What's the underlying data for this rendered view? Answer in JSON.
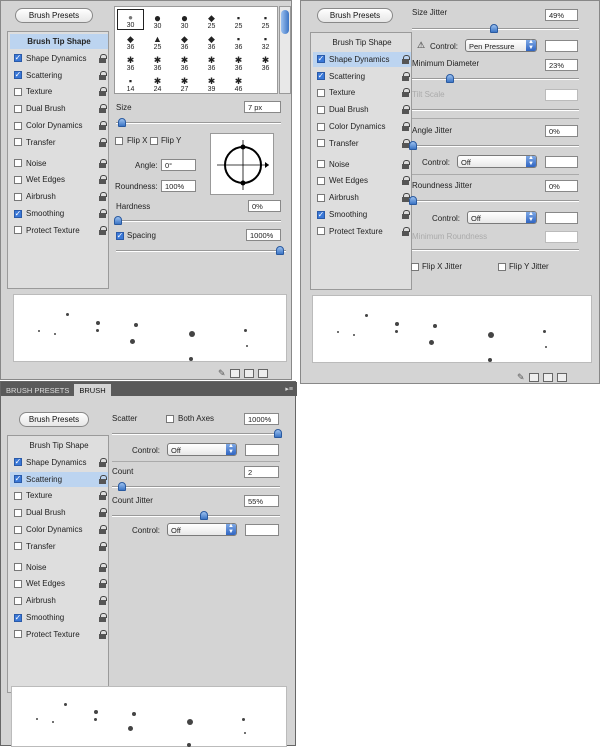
{
  "items_p1": [
    {
      "label": "Brush Tip Shape",
      "header": true,
      "selected": true
    },
    {
      "label": "Shape Dynamics",
      "checked": true
    },
    {
      "label": "Scattering",
      "checked": true
    },
    {
      "label": "Texture",
      "checked": false
    },
    {
      "label": "Dual Brush",
      "checked": false
    },
    {
      "label": "Color Dynamics",
      "checked": false
    },
    {
      "label": "Transfer",
      "checked": false
    },
    {
      "label": "Noise",
      "checked": false
    },
    {
      "label": "Wet Edges",
      "checked": false
    },
    {
      "label": "Airbrush",
      "checked": false
    },
    {
      "label": "Smoothing",
      "checked": true
    },
    {
      "label": "Protect Texture",
      "checked": false
    }
  ],
  "items_p2": [
    {
      "label": "Brush Tip Shape",
      "header": true
    },
    {
      "label": "Shape Dynamics",
      "checked": true,
      "selected": true
    },
    {
      "label": "Scattering",
      "checked": true
    },
    {
      "label": "Texture",
      "checked": false
    },
    {
      "label": "Dual Brush",
      "checked": false
    },
    {
      "label": "Color Dynamics",
      "checked": false
    },
    {
      "label": "Transfer",
      "checked": false
    },
    {
      "label": "Noise",
      "checked": false
    },
    {
      "label": "Wet Edges",
      "checked": false
    },
    {
      "label": "Airbrush",
      "checked": false
    },
    {
      "label": "Smoothing",
      "checked": true
    },
    {
      "label": "Protect Texture",
      "checked": false
    }
  ],
  "items_p3": [
    {
      "label": "Brush Tip Shape",
      "header": true
    },
    {
      "label": "Shape Dynamics",
      "checked": true
    },
    {
      "label": "Scattering",
      "checked": true,
      "selected": true
    },
    {
      "label": "Texture",
      "checked": false
    },
    {
      "label": "Dual Brush",
      "checked": false
    },
    {
      "label": "Color Dynamics",
      "checked": false
    },
    {
      "label": "Transfer",
      "checked": false
    },
    {
      "label": "Noise",
      "checked": false
    },
    {
      "label": "Wet Edges",
      "checked": false
    },
    {
      "label": "Airbrush",
      "checked": false
    },
    {
      "label": "Smoothing",
      "checked": true
    },
    {
      "label": "Protect Texture",
      "checked": false
    }
  ],
  "presets_label": "Brush Presets",
  "tabs": [
    "BRUSH PRESETS",
    "BRUSH"
  ],
  "brush_sizes": [
    "30",
    "30",
    "30",
    "25",
    "25",
    "25",
    "36",
    "25",
    "36",
    "36",
    "36",
    "32",
    "36",
    "36",
    "36",
    "36",
    "36",
    "36",
    "14",
    "24",
    "27",
    "39",
    "46"
  ],
  "tip": {
    "size_label": "Size",
    "size_value": "7 px",
    "flipx": "Flip X",
    "flipy": "Flip Y",
    "angle_label": "Angle:",
    "angle_value": "0°",
    "roundness_label": "Roundness:",
    "roundness_value": "100%",
    "hardness_label": "Hardness",
    "hardness_value": "0%",
    "spacing_label": "Spacing",
    "spacing_value": "1000%"
  },
  "shape": {
    "size_jitter_label": "Size Jitter",
    "size_jitter_value": "49%",
    "control_label": "Control:",
    "control1_value": "Pen Pressure",
    "min_diameter_label": "Minimum Diameter",
    "min_diameter_value": "23%",
    "tilt_label": "Tilt Scale",
    "angle_jitter_label": "Angle Jitter",
    "angle_jitter_value": "0%",
    "control2_value": "Off",
    "round_jitter_label": "Roundness Jitter",
    "round_jitter_value": "0%",
    "control3_value": "Off",
    "min_round_label": "Minimum Roundness",
    "flipx_jitter": "Flip X Jitter",
    "flipy_jitter": "Flip Y Jitter"
  },
  "scatter": {
    "scatter_label": "Scatter",
    "both_axes": "Both Axes",
    "scatter_value": "1000%",
    "control_label": "Control:",
    "control1_value": "Off",
    "count_label": "Count",
    "count_value": "2",
    "count_jitter_label": "Count Jitter",
    "count_jitter_value": "55%",
    "control2_value": "Off"
  },
  "colors": {
    "accent": "#3a78d8",
    "selection": "#bcd4f0",
    "panel": "#d4d4d4"
  }
}
